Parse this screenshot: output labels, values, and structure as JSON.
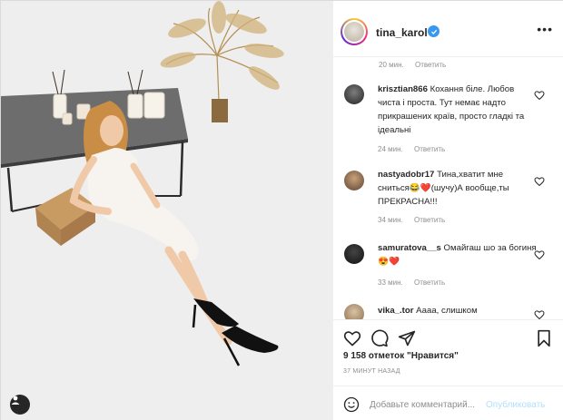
{
  "post": {
    "username": "tina_karol",
    "verified": true,
    "more_icon": "more-options-icon"
  },
  "comments": {
    "top_meta": {
      "time": "20 мин.",
      "reply": "Ответить"
    },
    "items": [
      {
        "user": "krisztian866",
        "text": "Кохання біле. Любов чиста і проста. Тут немає надто прикрашених країв, просто гладкі та ідеальні",
        "time": "24 мин.",
        "reply": "Ответить"
      },
      {
        "user": "nastyadobr17",
        "text": "Тина,хватит мне сниться😂❤️(шучу)А вообще,ты ПРЕКРАСНА!!!",
        "time": "34 мин.",
        "reply": "Ответить"
      },
      {
        "user": "samuratova__s",
        "text": "Омайгаш шо за богиня😍❤️",
        "time": "33 мин.",
        "reply": "Ответить"
      },
      {
        "user": "vika_.tor",
        "text": "Аааа, слишком"
      }
    ]
  },
  "stats": {
    "likes": "9 158 отметок \"Нравится\"",
    "time_ago": "37 МИНУТ НАЗАД"
  },
  "add_comment": {
    "placeholder": "Добавьте комментарий...",
    "publish": "Опубликовать"
  },
  "colors": {
    "accent": "#3897f0",
    "text": "#262626",
    "muted": "#8e8e8e",
    "heart": "#ed4956",
    "publish_disabled": "#b2dffc"
  }
}
